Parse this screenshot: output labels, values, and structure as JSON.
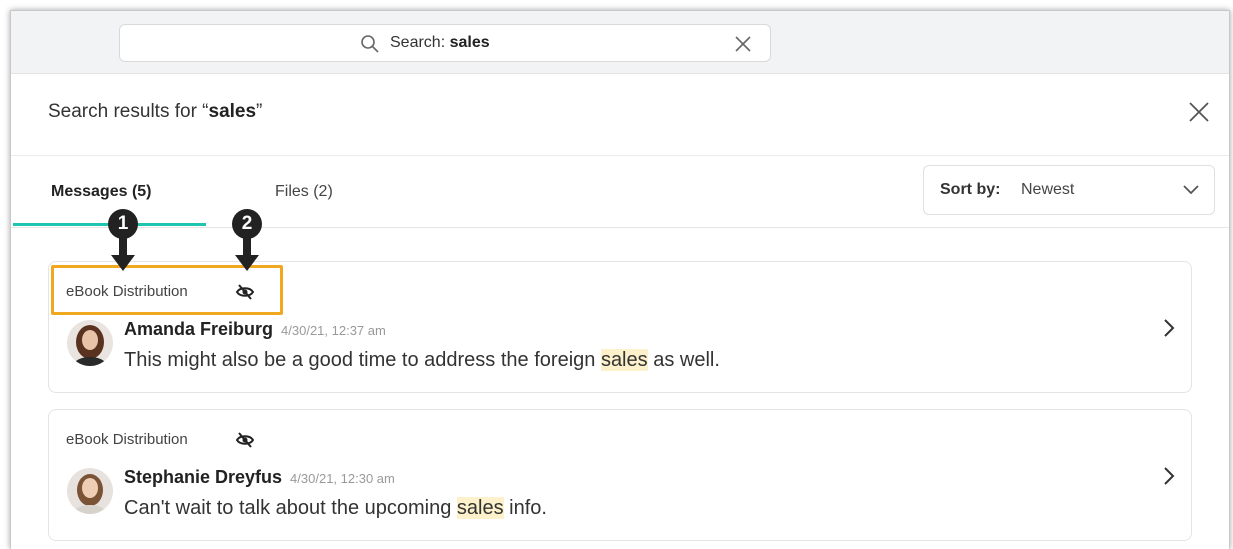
{
  "search": {
    "prefix": "Search:",
    "query": "sales"
  },
  "header": {
    "title_prefix": "Search results for “",
    "title_query": "sales",
    "title_suffix": "”"
  },
  "tabs": [
    {
      "label": "Messages (5)",
      "active": true
    },
    {
      "label": "Files (2)",
      "active": false
    }
  ],
  "sort": {
    "label": "Sort by:",
    "value": "Newest"
  },
  "callouts": [
    "1",
    "2"
  ],
  "results": [
    {
      "channel": "eBook Distribution",
      "author": "Amanda Freiburg",
      "timestamp": "4/30/21, 12:37 am",
      "message_before": "This might also be a good time to address the foreign ",
      "message_match": "sales",
      "message_after": " as well."
    },
    {
      "channel": "eBook Distribution",
      "author": "Stephanie Dreyfus",
      "timestamp": "4/30/21, 12:30 am",
      "message_before": "Can't wait to talk about the upcoming ",
      "message_match": "sales",
      "message_after": " info."
    }
  ],
  "colors": {
    "accent": "#1fc5b0",
    "highlight": "#fdf1cb",
    "annotation_border": "#f0a820"
  }
}
